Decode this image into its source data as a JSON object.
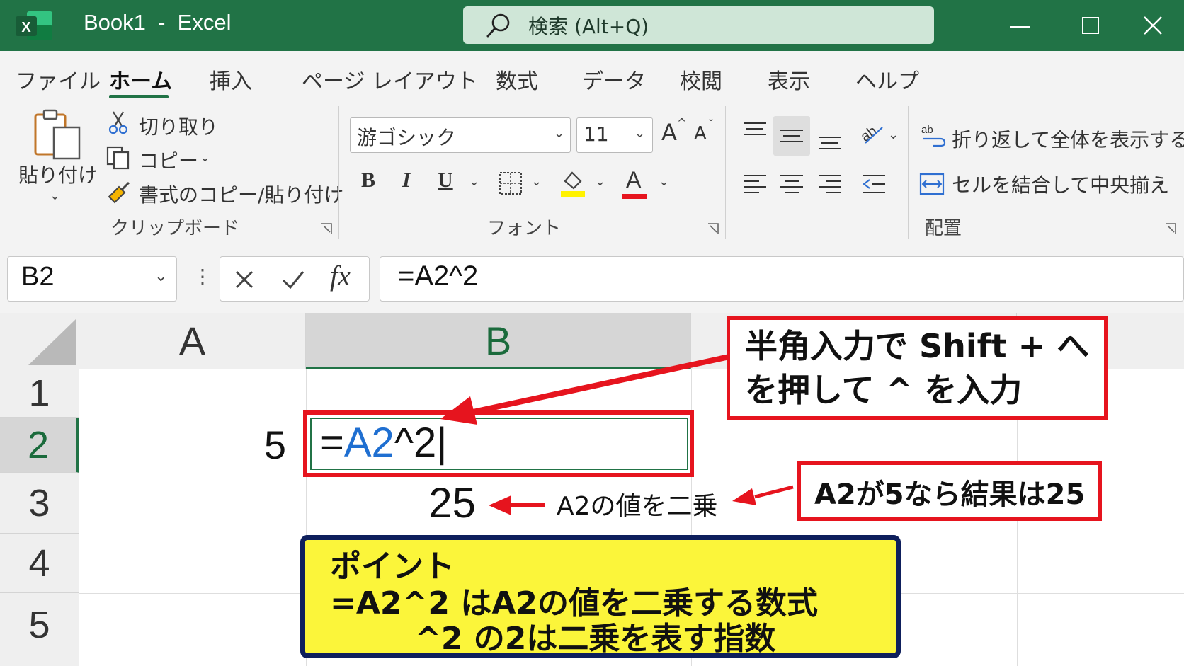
{
  "window": {
    "title": "Book1  -  Excel",
    "search_placeholder": "検索 (Alt+Q)",
    "logo_letter": "X",
    "accent_color": "#217346"
  },
  "menu": {
    "tabs": [
      "ファイル",
      "ホーム",
      "挿入",
      "ページ レイアウト",
      "数式",
      "データ",
      "校閲",
      "表示",
      "ヘルプ"
    ],
    "active_tab": "ホーム"
  },
  "ribbon": {
    "clipboard": {
      "paste_label": "貼り付け",
      "cut_label": "切り取り",
      "copy_label": "コピー",
      "format_painter_label": "書式のコピー/貼り付け",
      "group_label": "クリップボード"
    },
    "font": {
      "font_name": "游ゴシック",
      "font_size": "11",
      "bold": "B",
      "italic": "I",
      "underline": "U",
      "font_color_glyph": "A",
      "grow_font": "A",
      "shrink_font": "A",
      "group_label": "フォント"
    },
    "alignment": {
      "wrap_text_label": "折り返して全体を表示する",
      "merge_center_label": "セルを結合して中央揃え",
      "group_label": "配置"
    }
  },
  "formula_bar": {
    "name_box": "B2",
    "fx_label": "fx",
    "formula": "=A2^2"
  },
  "sheet": {
    "columns": [
      "A",
      "B"
    ],
    "rows": [
      "1",
      "2",
      "3",
      "4",
      "5"
    ],
    "cells": {
      "A2": "5",
      "B2_eq": "=",
      "B2_ref": "A2",
      "B2_rest": "^2",
      "B3": "25"
    },
    "selected_cell": "B2"
  },
  "annotations": {
    "callout_top_line1": "半角入力で Shift + へ",
    "callout_top_line2": "を押して ^ を入力",
    "callout_mid": "A2が5なら結果は25",
    "label_square": "A2の値を二乗",
    "point_title": "ポイント",
    "point_line1": "=A2^2 はA2の値を二乗する数式",
    "point_line2": "^2 の2は二乗を表す指数"
  },
  "colors": {
    "annotation_red": "#e6141e",
    "point_bg": "#fbf53a",
    "point_border": "#0e1f5c",
    "cell_ref_blue": "#1f6fd1"
  }
}
